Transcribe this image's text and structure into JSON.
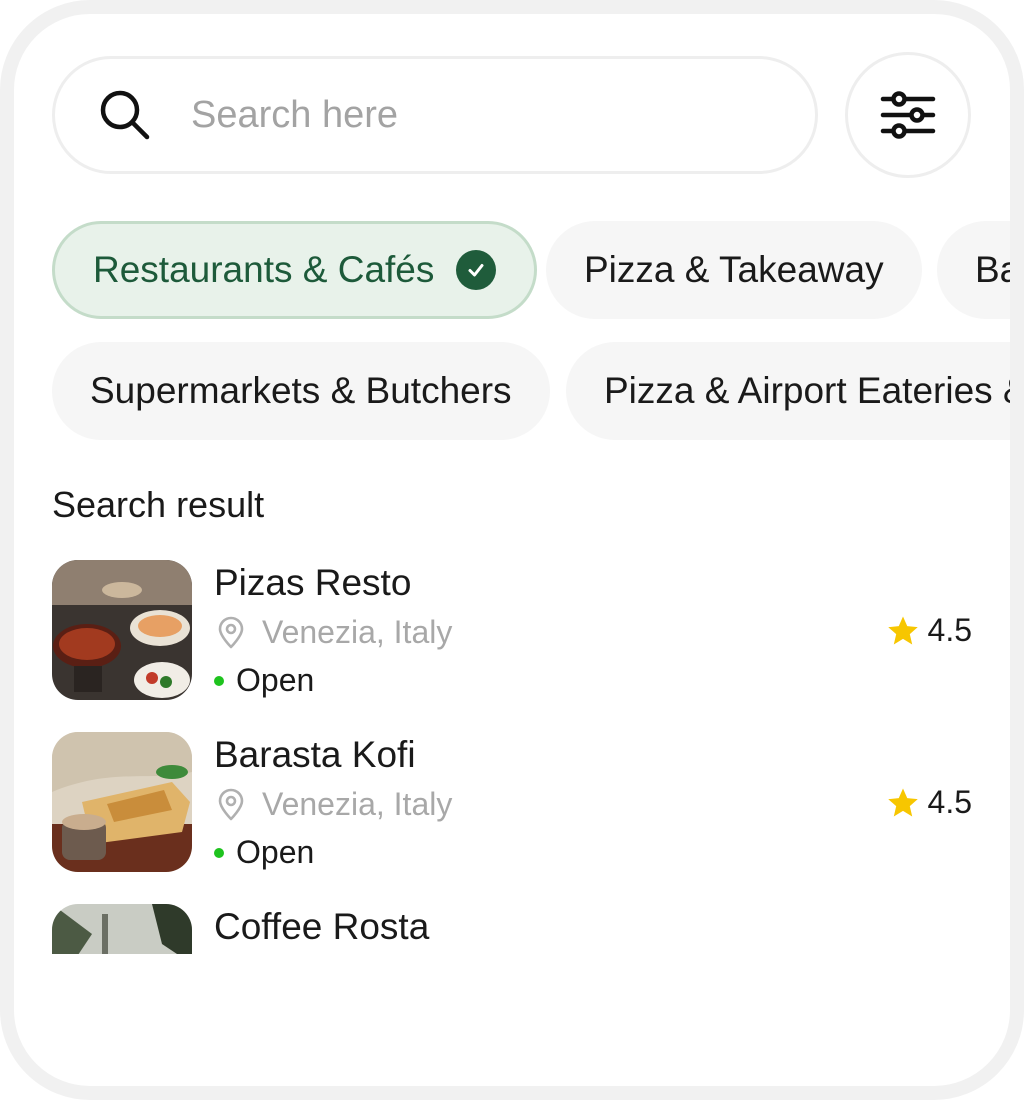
{
  "search": {
    "placeholder": "Search here",
    "value": ""
  },
  "icons": {
    "search": "search-icon",
    "filter": "sliders-icon",
    "check": "check-circle-icon",
    "location": "map-pin-icon",
    "rating": "star-icon"
  },
  "colors": {
    "active_chip_bg": "#e8f2ea",
    "active_chip_text": "#1d5a3a",
    "check_badge": "#1f5c3b",
    "open_dot": "#1ec31e",
    "star": "#f7c600"
  },
  "chips": [
    {
      "label": "Restaurants & Cafés",
      "selected": true
    },
    {
      "label": "Pizza & Takeaway",
      "selected": false
    },
    {
      "label": "Ba",
      "selected": false
    },
    {
      "label": "Supermarkets & Butchers",
      "selected": false
    },
    {
      "label": "Pizza & Airport Eateries &",
      "selected": false
    }
  ],
  "results_title": "Search result",
  "results": [
    {
      "name": "Pizas Resto",
      "location": "Venezia, Italy",
      "status": "Open",
      "rating": "4.5"
    },
    {
      "name": "Barasta Kofi",
      "location": "Venezia, Italy",
      "status": "Open",
      "rating": "4.5"
    },
    {
      "name": "Coffee Rosta",
      "location": "",
      "status": "",
      "rating": ""
    }
  ]
}
